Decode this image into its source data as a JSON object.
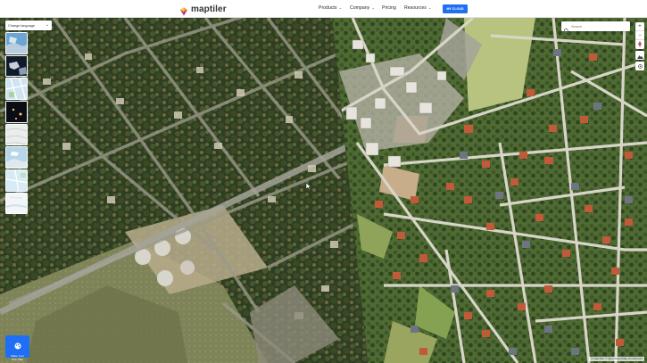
{
  "logo": {
    "text": "maptiler",
    "icon": "maptiler-logo-icon"
  },
  "nav": {
    "items": [
      {
        "label": "Products",
        "has_dropdown": true
      },
      {
        "label": "Company",
        "has_dropdown": true
      },
      {
        "label": "Pricing",
        "has_dropdown": false
      },
      {
        "label": "Resources",
        "has_dropdown": true
      }
    ],
    "cta_label": "MY CLOUD"
  },
  "language": {
    "label": "Change language"
  },
  "search": {
    "placeholder": "Search"
  },
  "map_controls": {
    "zoom_in": "+",
    "zoom_out": "−",
    "compass_icon": "compass-icon",
    "terrain_icon": "mountain-icon",
    "geolocate_icon": "geolocate-icon",
    "fullscreen_icon": "fullscreen-icon"
  },
  "style_thumbs": [
    {
      "name": "satellite-hybrid"
    },
    {
      "name": "dark-globe"
    },
    {
      "name": "streets"
    },
    {
      "name": "night-imagery"
    },
    {
      "name": "topo-light"
    },
    {
      "name": "outdoor"
    },
    {
      "name": "basic"
    },
    {
      "name": "winter"
    }
  ],
  "make_map": {
    "label": "Make Your Own Map",
    "icon": "palette-icon"
  },
  "attribution": "© MapTiler © OpenStreetMap contributors",
  "colors": {
    "brand_blue": "#1f6ff4",
    "logo_orange": "#f7a21b",
    "logo_purple": "#8b3ab4"
  }
}
